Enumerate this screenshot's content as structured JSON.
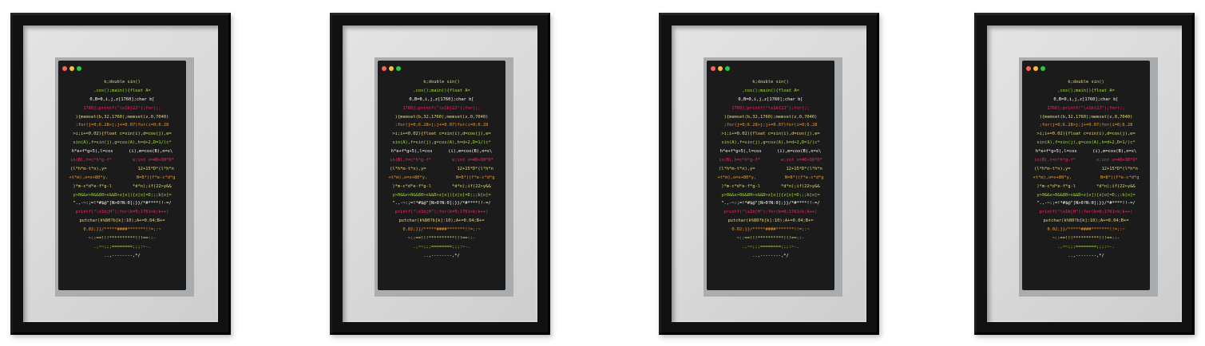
{
  "scene": {
    "background_color": "#ffffff",
    "frame_color": "#111111",
    "mat_color": "#dcdcdc",
    "screen_color": "#1b1b1b",
    "frame_count": 4
  },
  "code_lines": [
    "k;double sin()",
    ",cos();main(){float A=",
    "0,B=0,i,j,z[1760];char b[",
    "1760];printf(\"\\x1b[2J\");for(;;",
    "){memset(b,32,1760);memset(z,0,7040)",
    ";for(j=0;6.28>j;j+=0.07)for(i=0;6.28",
    ">i;i+=0.02){float c=sin(i),d=cos(j),e=",
    "sin(A),f=sin(j),g=cos(A),h=d+2,D=1/(c*",
    "h*e+f*g+5),l=cos      (i),m=cos(B),n=s\\",
    "in(B),t=c*h*g-f*        e;int x=40+30*D*",
    "(l*h*m-t*n),y=            12+15*D*(l*h*n",
    "+t*m),o=x+80*y,           N=8*((f*e-c*d*g",
    ")*m-c*d*e-f*g-l        *d*n);if(22>y&&",
    "y>0&&x>0&&80>x&&D>z[o]){z[o]=D;;;b[o]=",
    "\".,-~:;=!*#$@\"[N>0?N:0];}}/*#****!!-=/",
    "printf(\"\\x1b[H\");for(k=0;1761>k;k++)",
    "putchar(k%80?b[k]:10);A+=0.04;B+=",
    "0.02;}}/*****####*******!!=;:~",
    "~::==!!!**********!!!==::-",
    ".,~~;;;========;;;:~-.",
    "..,--------,*/"
  ],
  "icons": {
    "window_buttons": [
      "close-dot-icon",
      "minimize-dot-icon",
      "maximize-dot-icon"
    ],
    "colors": {
      "close": "#ff5f57",
      "minimize": "#febc2e",
      "maximize": "#28c840"
    }
  }
}
